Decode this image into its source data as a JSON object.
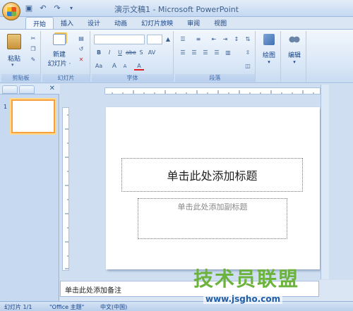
{
  "window": {
    "title": "演示文稿1 - Microsoft PowerPoint"
  },
  "qat": {
    "icons": [
      "save-icon",
      "undo-icon",
      "redo-icon",
      "customize-icon"
    ]
  },
  "tabs": [
    {
      "label": "开始",
      "active": true
    },
    {
      "label": "插入"
    },
    {
      "label": "设计"
    },
    {
      "label": "动画"
    },
    {
      "label": "幻灯片放映"
    },
    {
      "label": "审阅"
    },
    {
      "label": "视图"
    }
  ],
  "ribbon": {
    "clipboard": {
      "paste_label": "粘贴",
      "group_label": "剪贴板"
    },
    "slides": {
      "new_slide_line1": "新建",
      "new_slide_line2": "幻灯片 ·",
      "group_label": "幻灯片"
    },
    "font": {
      "group_label": "字体",
      "buttons": [
        "B",
        "I",
        "U",
        "abe",
        "S",
        "AV",
        "Aa",
        "A",
        "A",
        "A"
      ]
    },
    "paragraph": {
      "group_label": "段落"
    },
    "drawing": {
      "label": "绘图"
    },
    "editing": {
      "label": "编辑"
    }
  },
  "slide": {
    "title_placeholder": "单击此处添加标题",
    "subtitle_placeholder": "单击此处添加副标题",
    "thumbnail_number": "1"
  },
  "notes": {
    "placeholder": "单击此处添加备注"
  },
  "status": {
    "slide_info": "幻灯片 1/1",
    "theme": "\"Office 主题\"",
    "language": "中文(中国)"
  },
  "watermark": {
    "text": "技术员联盟",
    "url": "www.jsgho.com"
  },
  "colors": {
    "accent": "#15428b",
    "thumb_border": "#f7a23f",
    "watermark_green": "#6bb33a"
  }
}
